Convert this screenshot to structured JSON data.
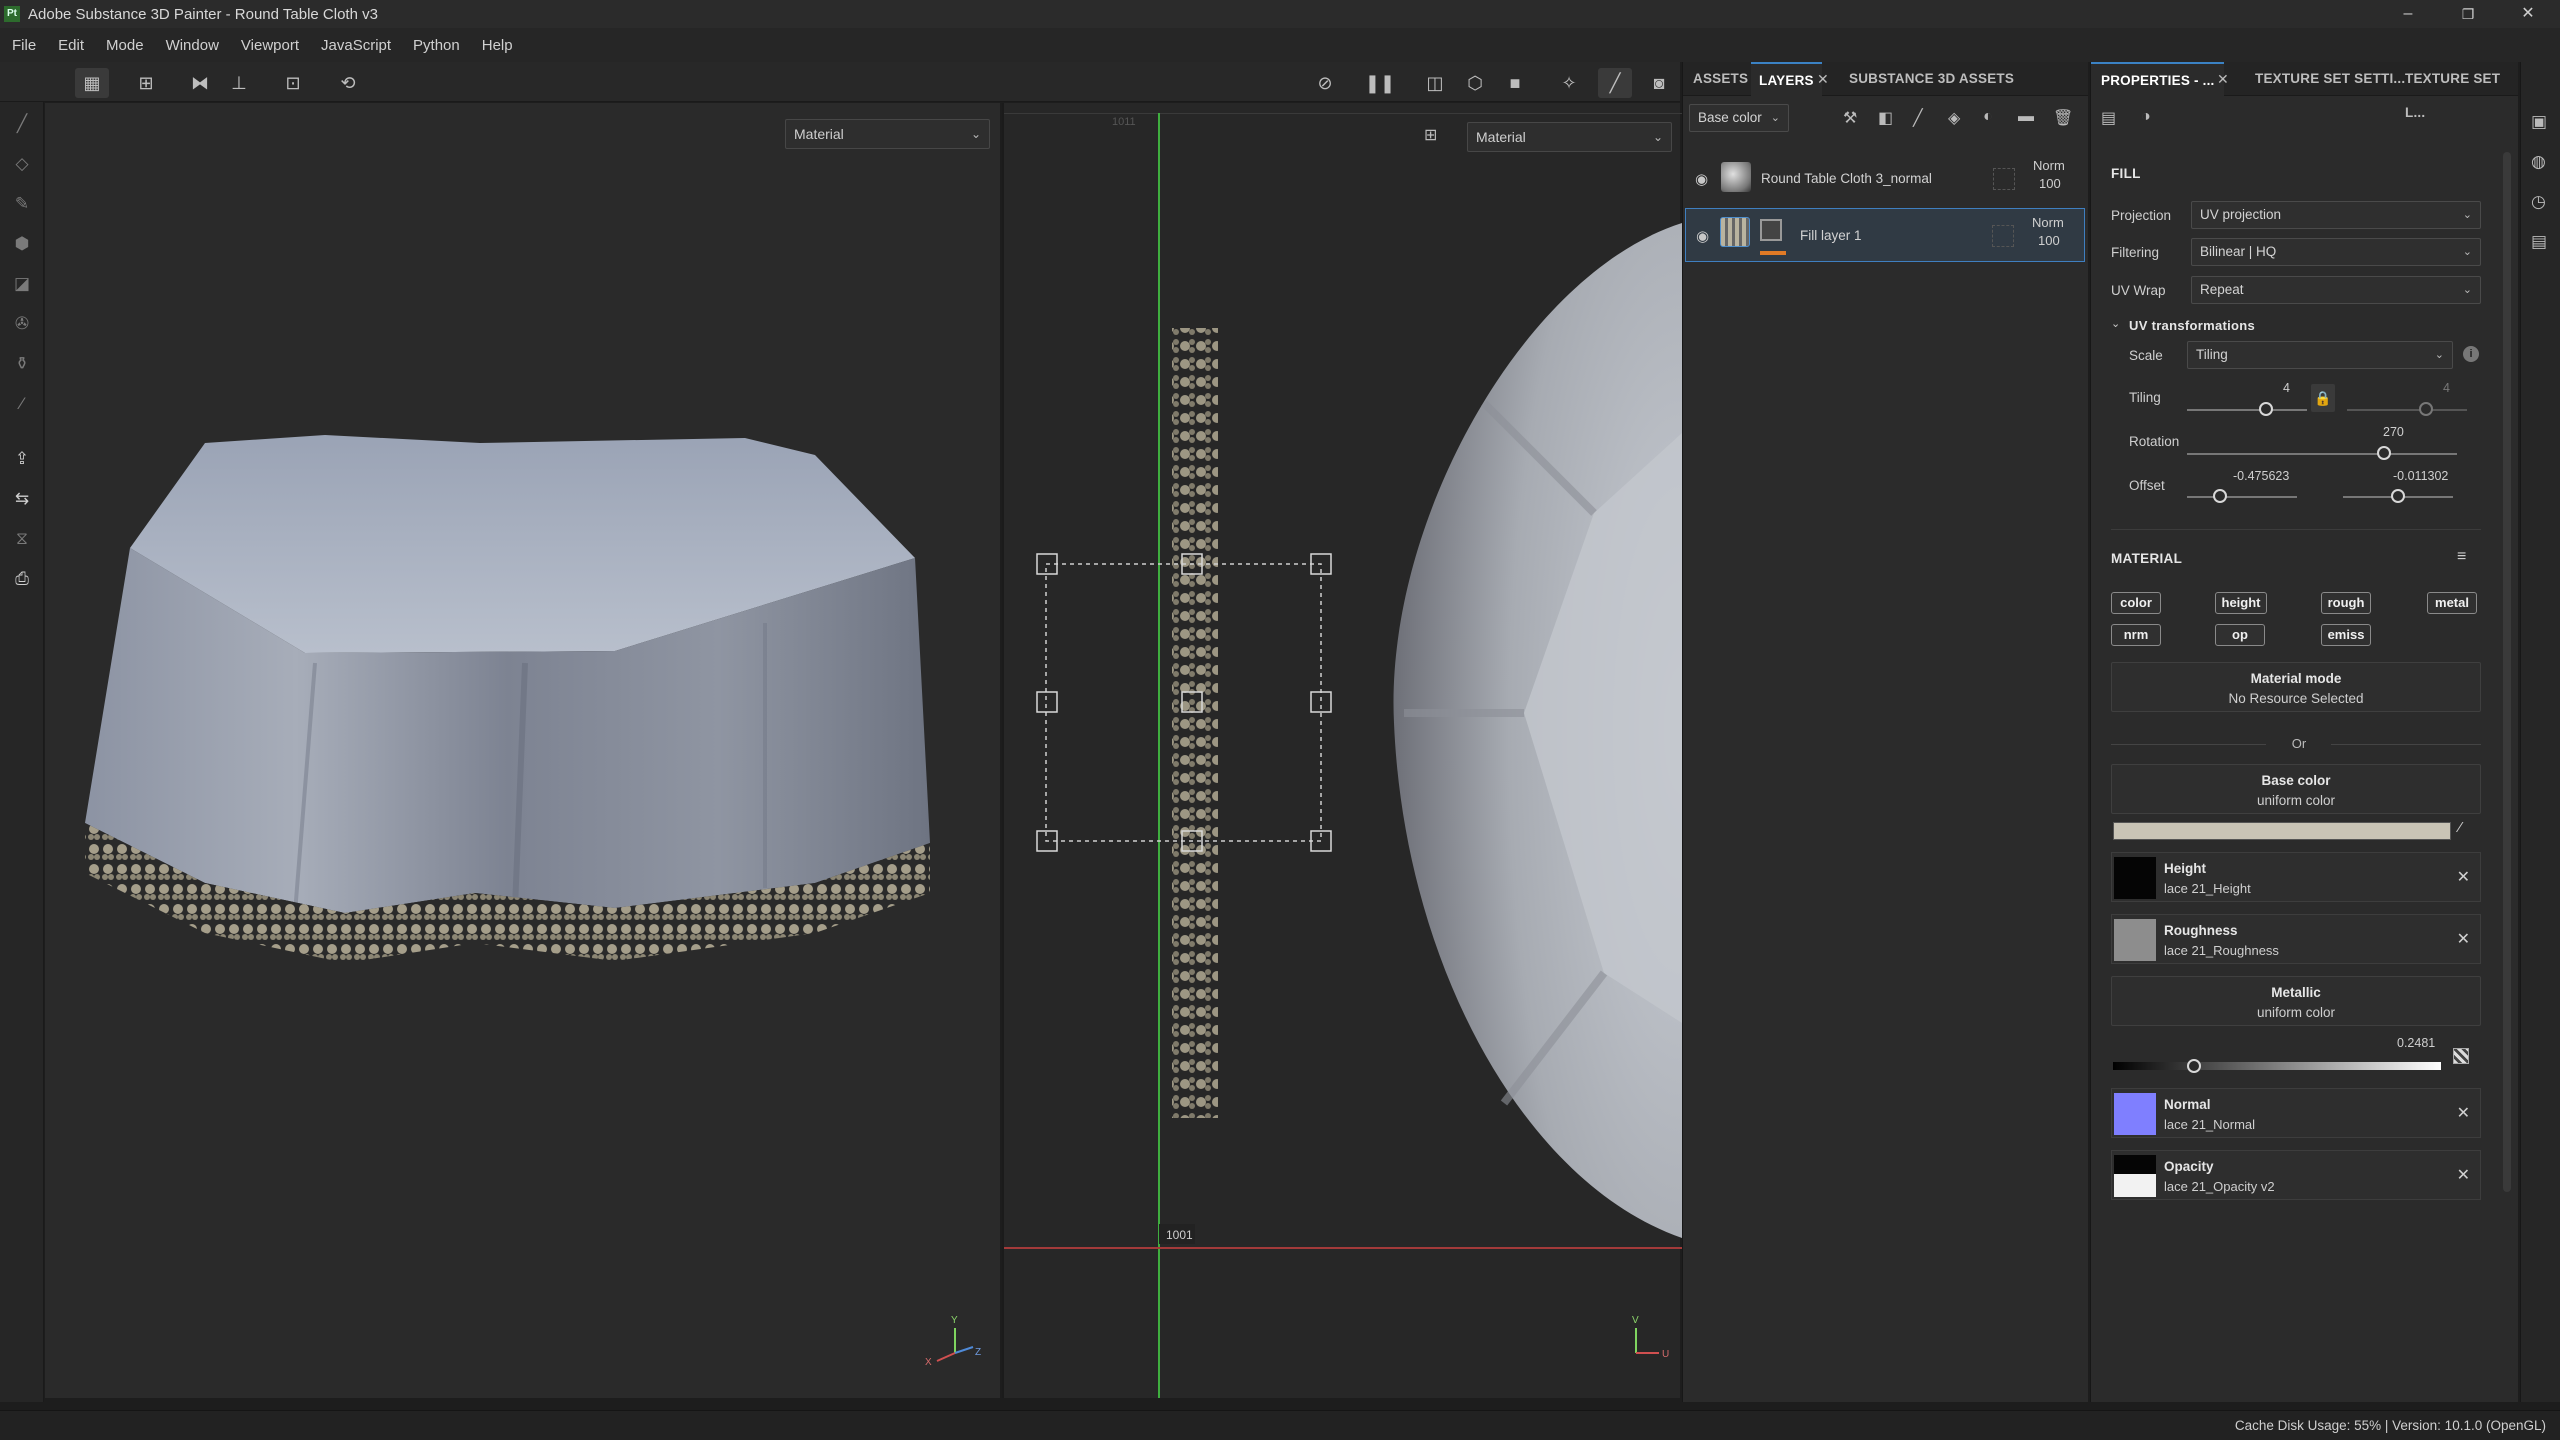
{
  "window": {
    "title": "Adobe Substance 3D Painter - Round Table Cloth v3",
    "logo": "Pt",
    "minimize": "–",
    "maximize": "❐",
    "close": "✕"
  },
  "menu": [
    "File",
    "Edit",
    "Mode",
    "Window",
    "Viewport",
    "JavaScript",
    "Python",
    "Help"
  ],
  "viewport3d": {
    "channel": "Material",
    "axis_y": "Y",
    "axis_x": "X",
    "axis_z": "Z"
  },
  "viewport2d": {
    "channel": "Material",
    "tile_top": "1011",
    "tile_bottom": "1001",
    "axis_v": "V",
    "axis_u": "U"
  },
  "layers_panel": {
    "tabs": [
      "ASSETS",
      "LAYERS",
      "SUBSTANCE 3D ASSETS"
    ],
    "channel": "Base color",
    "layers": [
      {
        "name": "Round Table Cloth 3_normal",
        "blend": "Norm",
        "opacity": "100"
      },
      {
        "name": "Fill layer 1",
        "blend": "Norm",
        "opacity": "100"
      }
    ]
  },
  "properties_panel": {
    "tabs": [
      "PROPERTIES - ...",
      "TEXTURE SET SETTI...",
      "TEXTURE SET L..."
    ],
    "fill_title": "FILL",
    "projection_label": "Projection",
    "projection_value": "UV projection",
    "filtering_label": "Filtering",
    "filtering_value": "Bilinear | HQ",
    "uvwrap_label": "UV Wrap",
    "uvwrap_value": "Repeat",
    "uvtrans_title": "UV transformations",
    "scale_label": "Scale",
    "scale_value": "Tiling",
    "tiling_label": "Tiling",
    "tiling_u": "4",
    "tiling_v": "4",
    "rotation_label": "Rotation",
    "rotation_value": "270",
    "offset_label": "Offset",
    "offset_u": "-0.475623",
    "offset_v": "-0.011302",
    "material_title": "MATERIAL",
    "channels": [
      "color",
      "height",
      "rough",
      "metal",
      "nrm",
      "op",
      "emiss"
    ],
    "material_mode_title": "Material mode",
    "material_mode_sub": "No Resource Selected",
    "or_text": "Or",
    "base_color_title": "Base color",
    "base_color_sub": "uniform color",
    "base_color_hex": "#c9c4b6",
    "height_name": "Height",
    "height_sub": "lace 21_Height",
    "roughness_name": "Roughness",
    "roughness_sub": "lace 21_Roughness",
    "metallic_title": "Metallic",
    "metallic_sub": "uniform color",
    "metallic_value": "0.2481",
    "normal_name": "Normal",
    "normal_sub": "lace 21_Normal",
    "opacity_name": "Opacity",
    "opacity_sub": "lace 21_Opacity v2"
  },
  "status": {
    "text": "Cache Disk Usage:     55% | Version: 10.1.0 (OpenGL)"
  },
  "colors": {
    "accent": "#3b82c4",
    "selection": "#303a44",
    "orange_mask": "#e07a26"
  }
}
